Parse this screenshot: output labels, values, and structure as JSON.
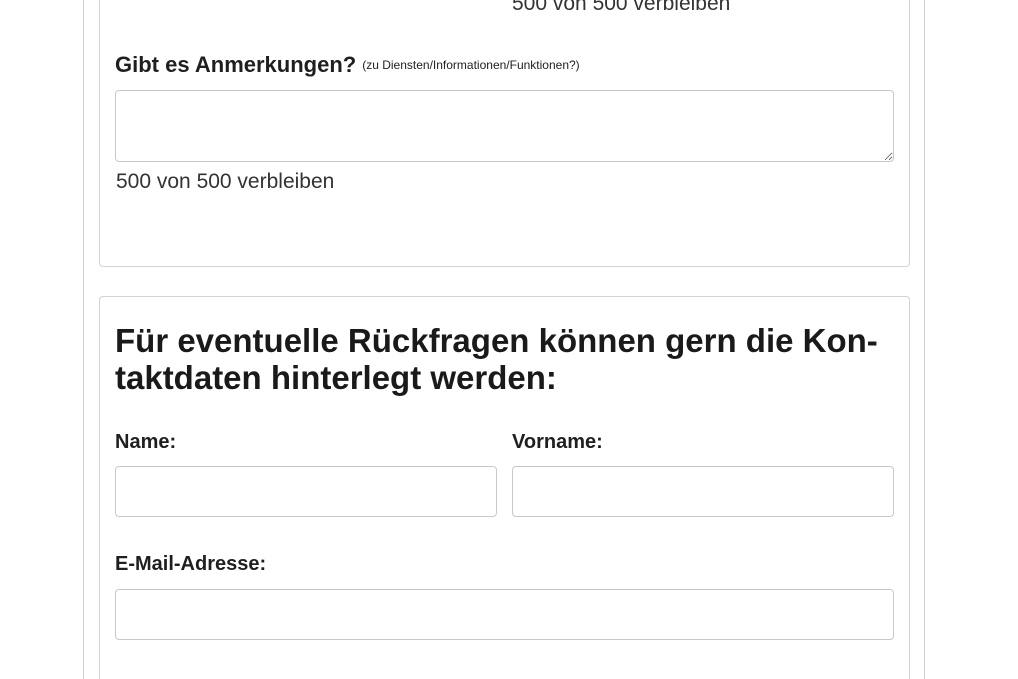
{
  "feedback_section": {
    "previous_counter": "500 von 500 verbleiben",
    "question_label": "Gibt es Anmerkungen?",
    "question_hint": "(zu Diensten/Informationen/Funktionen?)",
    "textarea_value": "",
    "counter": "500 von 500 verbleiben"
  },
  "contact_section": {
    "heading": "Für eventuelle Rückfragen können gern die Kon-taktdaten hinterlegt werden:",
    "name_label": "Name:",
    "name_value": "",
    "vorname_label": "Vorname:",
    "vorname_value": "",
    "email_label": "E-Mail-Adresse:",
    "email_value": ""
  }
}
